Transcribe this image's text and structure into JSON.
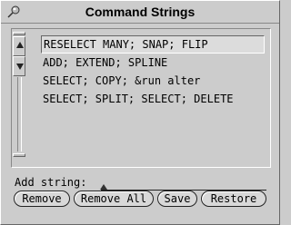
{
  "window": {
    "title": "Command Strings"
  },
  "icons": {
    "pin": "pushpin-icon",
    "scroll_up": "triangle-up-icon",
    "scroll_down": "triangle-down-icon"
  },
  "list": {
    "items": [
      {
        "label": "RESELECT MANY; SNAP; FLIP",
        "selected": true
      },
      {
        "label": "ADD; EXTEND; SPLINE",
        "selected": false
      },
      {
        "label": "SELECT; COPY; &run alter",
        "selected": false
      },
      {
        "label": "SELECT; SPLIT; SELECT; DELETE",
        "selected": false
      }
    ]
  },
  "add_string": {
    "label": "Add string:",
    "value": ""
  },
  "buttons": {
    "remove": "Remove",
    "remove_all": "Remove All",
    "save": "Save",
    "restore": "Restore"
  }
}
